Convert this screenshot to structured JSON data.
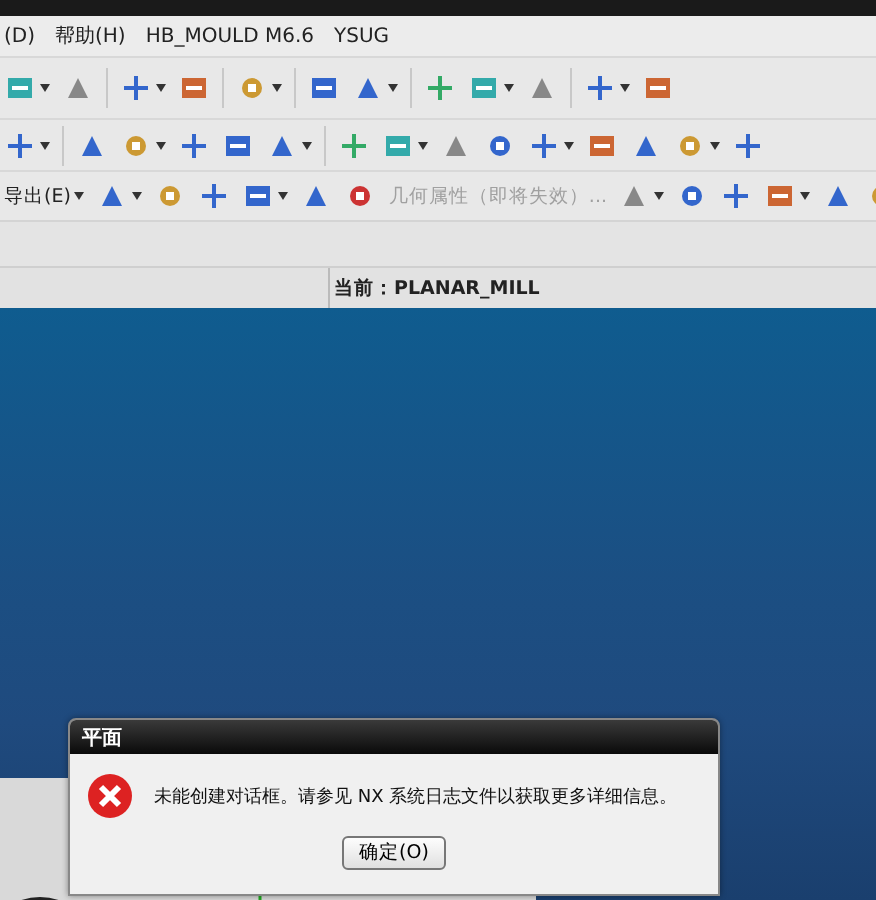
{
  "menu_bar": {
    "items": [
      {
        "label": "(D)"
      },
      {
        "label": "帮助(H)"
      },
      {
        "label": "HB_MOULD M6.6"
      },
      {
        "label": "YSUG"
      }
    ]
  },
  "toolbar_3": {
    "items": [
      {
        "kind": "menu",
        "label": "导出(E)",
        "disabled": false
      },
      {
        "kind": "command",
        "label": "几何属性（即将失效）...",
        "disabled": true
      }
    ]
  },
  "status_bar": {
    "current": "当前：PLANAR_MILL"
  },
  "dialog": {
    "title": "平面",
    "message": "未能创建对话框。请参见 NX 系统日志文件以获取更多详细信息。",
    "button": "确定(O)"
  }
}
